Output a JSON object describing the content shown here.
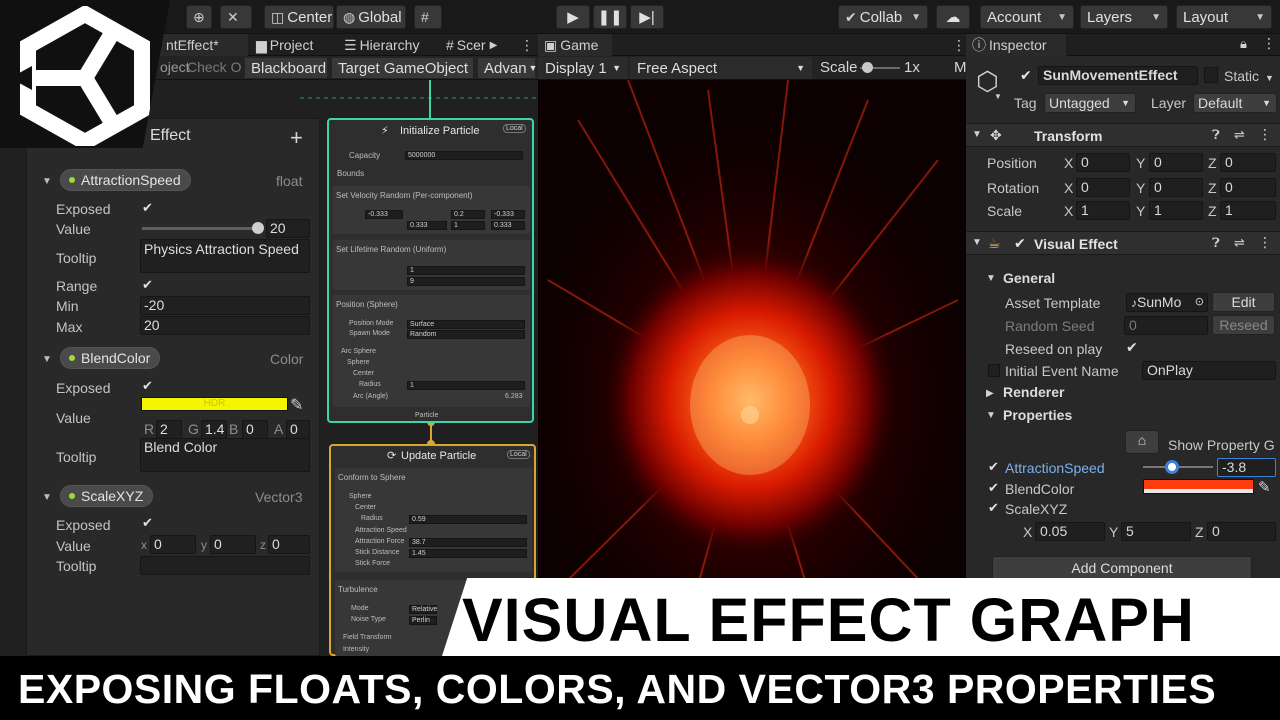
{
  "toolbar": {
    "center": "Center",
    "global": "Global",
    "collab": "Collab",
    "account": "Account",
    "layers": "Layers",
    "layout": "Layout"
  },
  "vfx": {
    "tabs": [
      "ntEffect*",
      "Project",
      "Hierarchy",
      "Scer"
    ],
    "object_field": "oject",
    "check_label": "Check O",
    "blackboard_button": "Blackboard",
    "target_button": "Target GameObject",
    "advanced_button": "Advan",
    "blackboard": {
      "title": "Effect",
      "properties": [
        {
          "name": "AttractionSpeed",
          "type": "float",
          "exposed_label": "Exposed",
          "value_label": "Value",
          "value": "20",
          "tooltip_label": "Tooltip",
          "tooltip": "Physics Attraction Speed",
          "range_label": "Range",
          "min_label": "Min",
          "min": "-20",
          "max_label": "Max",
          "max": "20"
        },
        {
          "name": "BlendColor",
          "type": "Color",
          "exposed_label": "Exposed",
          "value_label": "Value",
          "hdr": "HDR",
          "swatch_color": "#f5f500",
          "r_label": "R",
          "r": "2",
          "g_label": "G",
          "g": "1.4",
          "b_label": "B",
          "b": "0",
          "a_label": "A",
          "a": "0",
          "tooltip_label": "Tooltip",
          "tooltip": "Blend Color"
        },
        {
          "name": "ScaleXYZ",
          "type": "Vector3",
          "exposed_label": "Exposed",
          "value_label": "Value",
          "x_label": "x",
          "x": "0",
          "y_label": "y",
          "y": "0",
          "z_label": "z",
          "z": "0",
          "tooltip_label": "Tooltip"
        }
      ]
    },
    "nodes": {
      "initialize": {
        "title": "Initialize Particle",
        "badge": "Local",
        "capacity_label": "Capacity",
        "capacity": "5000000",
        "bounds_label": "Bounds",
        "velocity_title": "Set Velocity Random (Per-component)",
        "vel_a": [
          "-0.333",
          "0.2",
          "-0.333"
        ],
        "vel_b": [
          "0.333",
          "1",
          "0.333"
        ],
        "lifetime_title": "Set Lifetime Random (Uniform)",
        "life_a": "1",
        "life_b": "9",
        "position_title": "Position (Sphere)",
        "pos_mode_label": "Position Mode",
        "pos_mode": "Surface",
        "spawn_mode_label": "Spawn Mode",
        "spawn_mode": "Random",
        "arc_sphere_label": "Arc Sphere",
        "sphere_label": "Sphere",
        "center_label": "Center",
        "radius_label": "Radius",
        "radius": "1",
        "arc_label": "Arc (Angle)",
        "arc": "6.283",
        "out_label": "Particle"
      },
      "update": {
        "title": "Update Particle",
        "badge": "Local",
        "conform_title": "Conform to Sphere",
        "sphere_label": "Sphere",
        "center_label": "Center",
        "radius_label": "Radius",
        "radius": "0.59",
        "speed_label": "Attraction Speed",
        "force_label": "Attraction Force",
        "force": "38.7",
        "stick_dist_label": "Stick Distance",
        "stick_dist": "1.45",
        "stick_force_label": "Stick Force",
        "turb_title": "Turbulence",
        "mode_label": "Mode",
        "mode": "Relative",
        "noise_label": "Noise Type",
        "noise": "Perlin",
        "field_label": "Field Transform",
        "intensity_label": "Intensity"
      }
    }
  },
  "game": {
    "tab": "Game",
    "display": "Display 1",
    "aspect": "Free Aspect",
    "scale_label": "Scale",
    "scale_value": "1x",
    "more": "M"
  },
  "inspector": {
    "tab": "Inspector",
    "object_name": "SunMovementEffect",
    "static_label": "Static",
    "tag_label": "Tag",
    "tag": "Untagged",
    "layer_label": "Layer",
    "layer": "Default",
    "transform": {
      "title": "Transform",
      "position_label": "Position",
      "position": [
        "0",
        "0",
        "0"
      ],
      "rotation_label": "Rotation",
      "rotation": [
        "0",
        "0",
        "0"
      ],
      "scale_label": "Scale",
      "scale": [
        "1",
        "1",
        "1"
      ]
    },
    "visual_effect": {
      "title": "Visual Effect",
      "general_label": "General",
      "asset_template_label": "Asset Template",
      "asset_template": "SunMo",
      "edit_button": "Edit",
      "random_seed_label": "Random Seed",
      "random_seed": "0",
      "reseed_button": "Reseed",
      "reseed_on_play_label": "Reseed on play",
      "initial_event_label": "Initial Event Name",
      "initial_event": "OnPlay",
      "renderer_label": "Renderer",
      "properties_label": "Properties",
      "show_property_label": "Show Property G",
      "props": {
        "attraction_label": "AttractionSpeed",
        "attraction_value": "-3.8",
        "blend_label": "BlendColor",
        "scale_label": "ScaleXYZ",
        "scale_x": "0.05",
        "scale_y": "5",
        "scale_z": "0"
      }
    },
    "add_component": "Add Component"
  },
  "titles": {
    "main": "VISUAL EFFECT GRAPH",
    "sub": "EXPOSING FLOATS, COLORS, AND VECTOR3 PROPERTIES"
  },
  "colors": {
    "accent_gold": "#d8a72d",
    "accent_teal": "#3ad6a8",
    "property_dot": "#9bdc3c",
    "link_blue": "#7cb1ea",
    "hdr_yellow": "#f5f500"
  }
}
